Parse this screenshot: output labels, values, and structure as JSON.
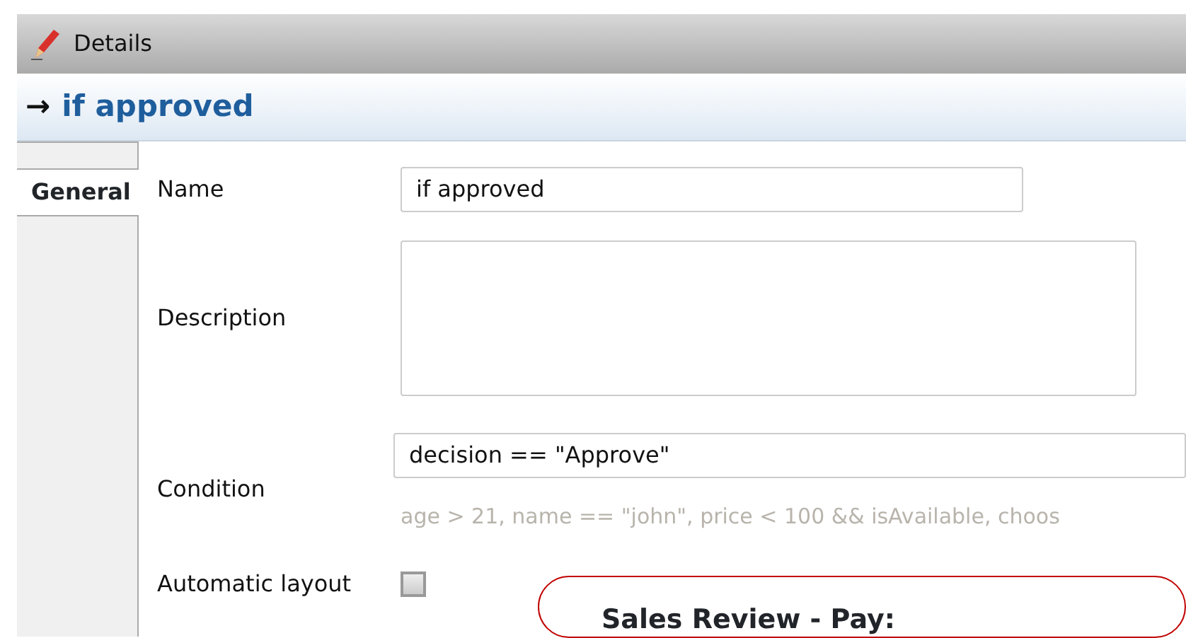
{
  "window": {
    "title": "Details"
  },
  "header": {
    "arrow": "→",
    "title": "if approved"
  },
  "tabs": [
    {
      "selected": false
    },
    {
      "label": "General",
      "selected": true
    }
  ],
  "form": {
    "name": {
      "label": "Name",
      "value": "if approved"
    },
    "description": {
      "label": "Description"
    },
    "condition": {
      "label": "Condition",
      "value": "decision == \"Approve\"",
      "hint": "age > 21, name == \"john\",  price < 100 && isAvailable, choos"
    },
    "automatic_layout": {
      "label": "Automatic layout",
      "checked": false
    }
  },
  "shape": {
    "title": "Sales Review - Pay:"
  }
}
